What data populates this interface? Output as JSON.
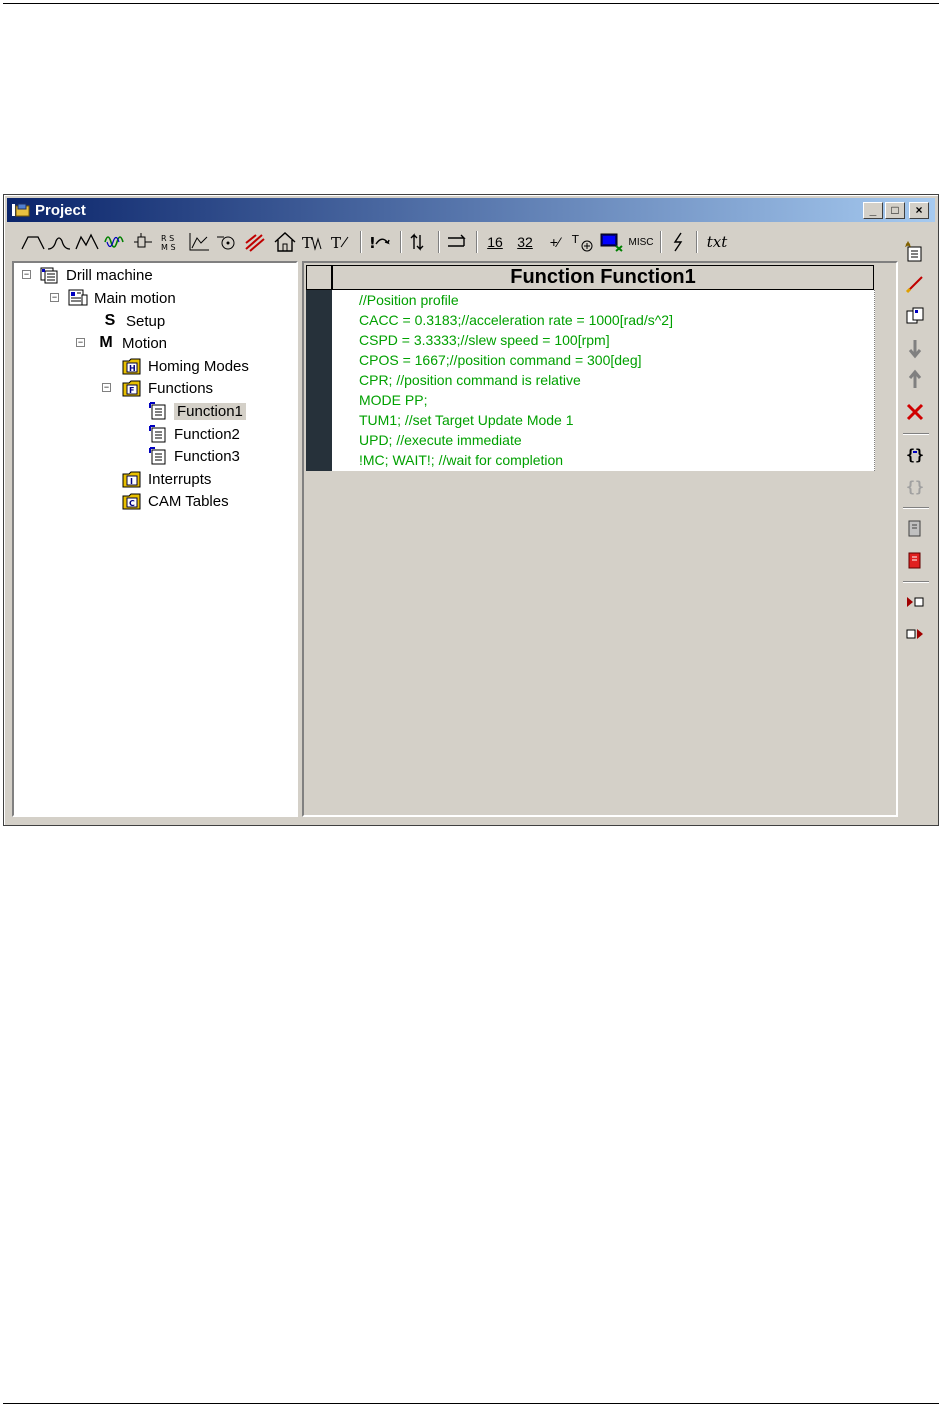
{
  "window": {
    "title": "Project",
    "min_glyph": "_",
    "max_glyph": "□",
    "close_glyph": "×"
  },
  "toolbar": {
    "items": [
      {
        "name": "trapezoidal-profile",
        "glyph": "⌒"
      },
      {
        "name": "s-curve-profile",
        "glyph": "⋀"
      },
      {
        "name": "pt-profile",
        "glyph": "⋀⋀"
      },
      {
        "name": "sine-profile",
        "glyph": "∿"
      },
      {
        "name": "position-contour",
        "glyph": "⊦"
      },
      {
        "name": "mode-settings",
        "glyph": "⁞⁞"
      },
      {
        "name": "speed-profile",
        "glyph": "⊾"
      },
      {
        "name": "cam-profile",
        "glyph": "⊙"
      },
      {
        "name": "stop-motion",
        "glyph": "✕"
      },
      {
        "name": "homing",
        "glyph": "⌂"
      },
      {
        "name": "time-move",
        "glyph": "W"
      },
      {
        "name": "test-event",
        "glyph": "T"
      },
      {
        "name": "goto-call",
        "glyph": "!⤳"
      },
      {
        "name": "jump",
        "glyph": "↱"
      },
      {
        "name": "data-transfer",
        "glyph": "⇄"
      },
      {
        "name": "assign-16",
        "glyph": "16"
      },
      {
        "name": "assign-32",
        "glyph": "32"
      },
      {
        "name": "arithmetic",
        "glyph": "+⁄"
      },
      {
        "name": "io-settings",
        "glyph": "⚙"
      },
      {
        "name": "monitor",
        "glyph": "▣"
      },
      {
        "name": "misc",
        "glyph": "MISC"
      },
      {
        "name": "interrupt",
        "glyph": "ϟ"
      },
      {
        "name": "text-edit",
        "glyph": "txt"
      }
    ]
  },
  "tree": {
    "items": [
      {
        "label": "Drill machine",
        "expander": "−"
      },
      {
        "label": "Main motion",
        "expander": "−"
      },
      {
        "label": "Setup",
        "glyph": "S"
      },
      {
        "label": "Motion",
        "expander": "−",
        "glyph": "M"
      },
      {
        "label": "Homing Modes",
        "glyph": "H"
      },
      {
        "label": "Functions",
        "expander": "−",
        "glyph": "F"
      },
      {
        "label": "Function1",
        "selected": true
      },
      {
        "label": "Function2"
      },
      {
        "label": "Function3"
      },
      {
        "label": "Interrupts",
        "glyph": "I"
      },
      {
        "label": "CAM Tables",
        "glyph": "C"
      }
    ]
  },
  "editor": {
    "title": "Function Function1",
    "lines": [
      "//Position profile",
      "CACC = 0.3183;//acceleration rate = 1000[rad/s^2]",
      "CSPD = 3.3333;//slew speed = 100[rpm]",
      "CPOS = 1667;//position command = 300[deg]",
      "CPR; //position command is relative",
      "MODE PP;",
      "TUM1; //set Target Update Mode 1",
      "UPD; //execute immediate",
      "!MC; WAIT!; //wait for completion"
    ]
  },
  "right_toolbar": {
    "items": [
      "new-item-icon",
      "edit-icon",
      "copy-icon",
      "move-down-icon",
      "move-up-icon",
      "delete-icon",
      "insert-block-icon",
      "disabled-block-icon",
      "page-icon",
      "red-page-icon",
      "run-to-icon",
      "run-from-icon"
    ]
  },
  "links": {
    "items": [
      "",
      "",
      "",
      ""
    ]
  },
  "colors": {
    "title_start": "#0a246a",
    "title_end": "#a6caf0",
    "code_green": "#00a000",
    "face": "#d4d0c8"
  }
}
